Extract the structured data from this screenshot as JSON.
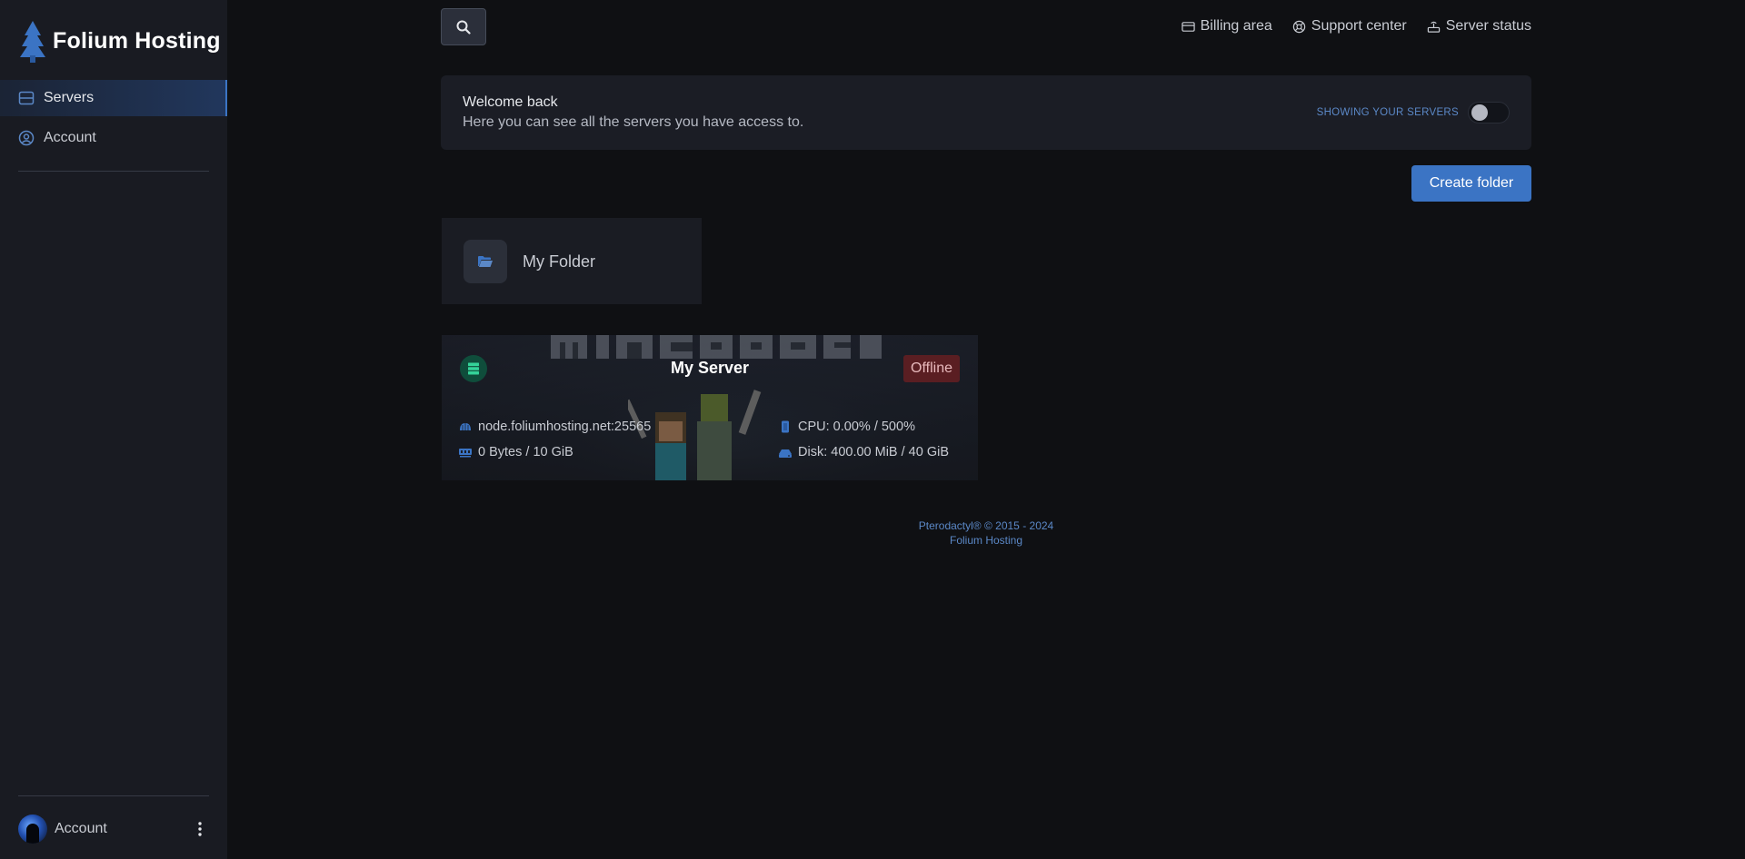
{
  "brand": {
    "name": "Folium Hosting"
  },
  "sidebar": {
    "items": [
      {
        "label": "Servers",
        "icon": "server-icon",
        "active": true
      },
      {
        "label": "Account",
        "icon": "user-circle-icon",
        "active": false
      }
    ],
    "user": {
      "label": "Account"
    }
  },
  "topbar": {
    "links": [
      {
        "label": "Billing area",
        "icon": "credit-card-icon"
      },
      {
        "label": "Support center",
        "icon": "lifebuoy-icon"
      },
      {
        "label": "Server status",
        "icon": "status-icon"
      }
    ]
  },
  "welcome": {
    "title": "Welcome back",
    "subtitle": "Here you can see all the servers you have access to.",
    "toggle_label": "SHOWING YOUR SERVERS"
  },
  "actions": {
    "create_folder": "Create folder"
  },
  "folders": [
    {
      "name": "My Folder"
    }
  ],
  "servers": [
    {
      "name": "My Server",
      "status": "Offline",
      "address": "node.foliumhosting.net:25565",
      "cpu": "CPU: 0.00% / 500%",
      "memory": "0 Bytes / 10 GiB",
      "disk": "Disk: 400.00 MiB / 40 GiB"
    }
  ],
  "footer": {
    "line1": "Pterodactyl® © 2015 - 2024",
    "line2": "Folium Hosting"
  },
  "colors": {
    "accent": "#3b74c4",
    "offline": "#5a1e22",
    "background": "#0f1013",
    "sidebar": "#191b22"
  }
}
